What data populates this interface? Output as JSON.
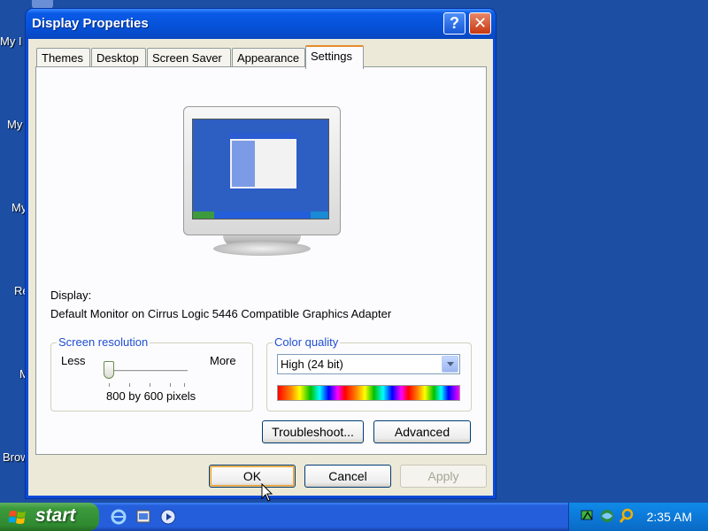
{
  "desktop": {
    "icon_labels": [
      "My I",
      "My",
      "My",
      "Re",
      "M",
      "Brow"
    ]
  },
  "dialog": {
    "title": "Display Properties",
    "help_glyph": "?",
    "close_glyph": "✕",
    "tabs": [
      {
        "label": "Themes",
        "active": false
      },
      {
        "label": "Desktop",
        "active": false
      },
      {
        "label": "Screen Saver",
        "active": false
      },
      {
        "label": "Appearance",
        "active": false
      },
      {
        "label": "Settings",
        "active": true
      }
    ],
    "display_label": "Display:",
    "display_device": "Default Monitor on Cirrus Logic 5446 Compatible Graphics Adapter",
    "screen_resolution": {
      "group_label": "Screen resolution",
      "less_label": "Less",
      "more_label": "More",
      "value_text": "800 by 600 pixels",
      "slider_level": 0.0
    },
    "color_quality": {
      "group_label": "Color quality",
      "selected": "High (24 bit)"
    },
    "buttons": {
      "troubleshoot": "Troubleshoot...",
      "advanced": "Advanced",
      "ok": "OK",
      "cancel": "Cancel",
      "apply": "Apply"
    }
  },
  "taskbar": {
    "start_label": "start",
    "clock": "2:35 AM"
  },
  "colors": {
    "desktop_bg": "#1c4ea3",
    "title_bar": "#0552d8",
    "dialog_bg": "#ece9d8",
    "group_label": "#1f4ed0",
    "start_button": "#3c9a3c",
    "taskbar": "#245edb"
  }
}
